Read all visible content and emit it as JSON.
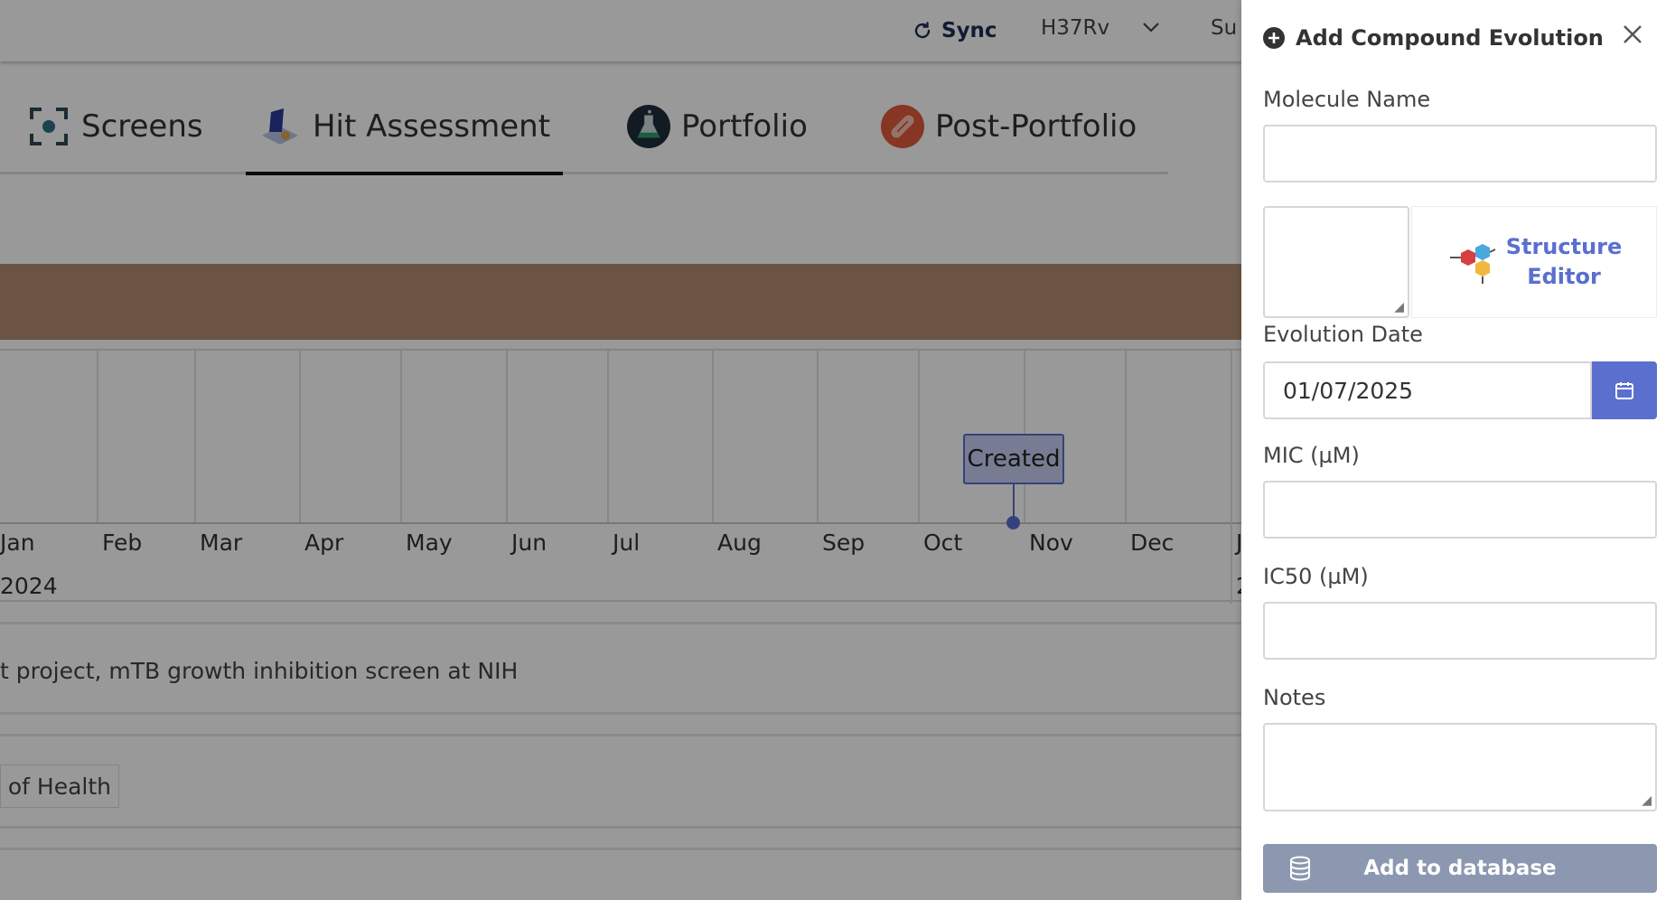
{
  "topbar": {
    "sync_label": "Sync",
    "organism": "H37Rv",
    "truncated_item": "Su"
  },
  "tabs": [
    {
      "label": "Screens"
    },
    {
      "label": "Hit Assessment"
    },
    {
      "label": "Portfolio"
    },
    {
      "label": "Post-Portfolio"
    }
  ],
  "timeline": {
    "months": [
      "Jan",
      "Feb",
      "Mar",
      "Apr",
      "May",
      "Jun",
      "Jul",
      "Aug",
      "Sep",
      "Oct",
      "Nov",
      "Dec",
      "J"
    ],
    "year": "2024",
    "event_label": "Created",
    "trailing_fragment": "2"
  },
  "description": "t project, mTB growth inhibition screen at NIH",
  "org_chip": "es of Health",
  "panel": {
    "title": "Add Compound Evolution",
    "molecule_name_label": "Molecule Name",
    "molecule_name_value": "",
    "smiles_value": "",
    "structure_editor_line1": "Structure",
    "structure_editor_line2": "Editor",
    "evolution_date_label": "Evolution Date",
    "evolution_date_value": "01/07/2025",
    "mic_label": "MIC (µM)",
    "mic_value": "",
    "ic50_label": "IC50 (µM)",
    "ic50_value": "",
    "notes_label": "Notes",
    "notes_value": "",
    "submit_label": "Add to database"
  },
  "colors": {
    "accent": "#5a6fce",
    "banner": "#b28c70",
    "submit": "#8b98b0",
    "overlay": "rgba(0,0,0,0.4)"
  }
}
